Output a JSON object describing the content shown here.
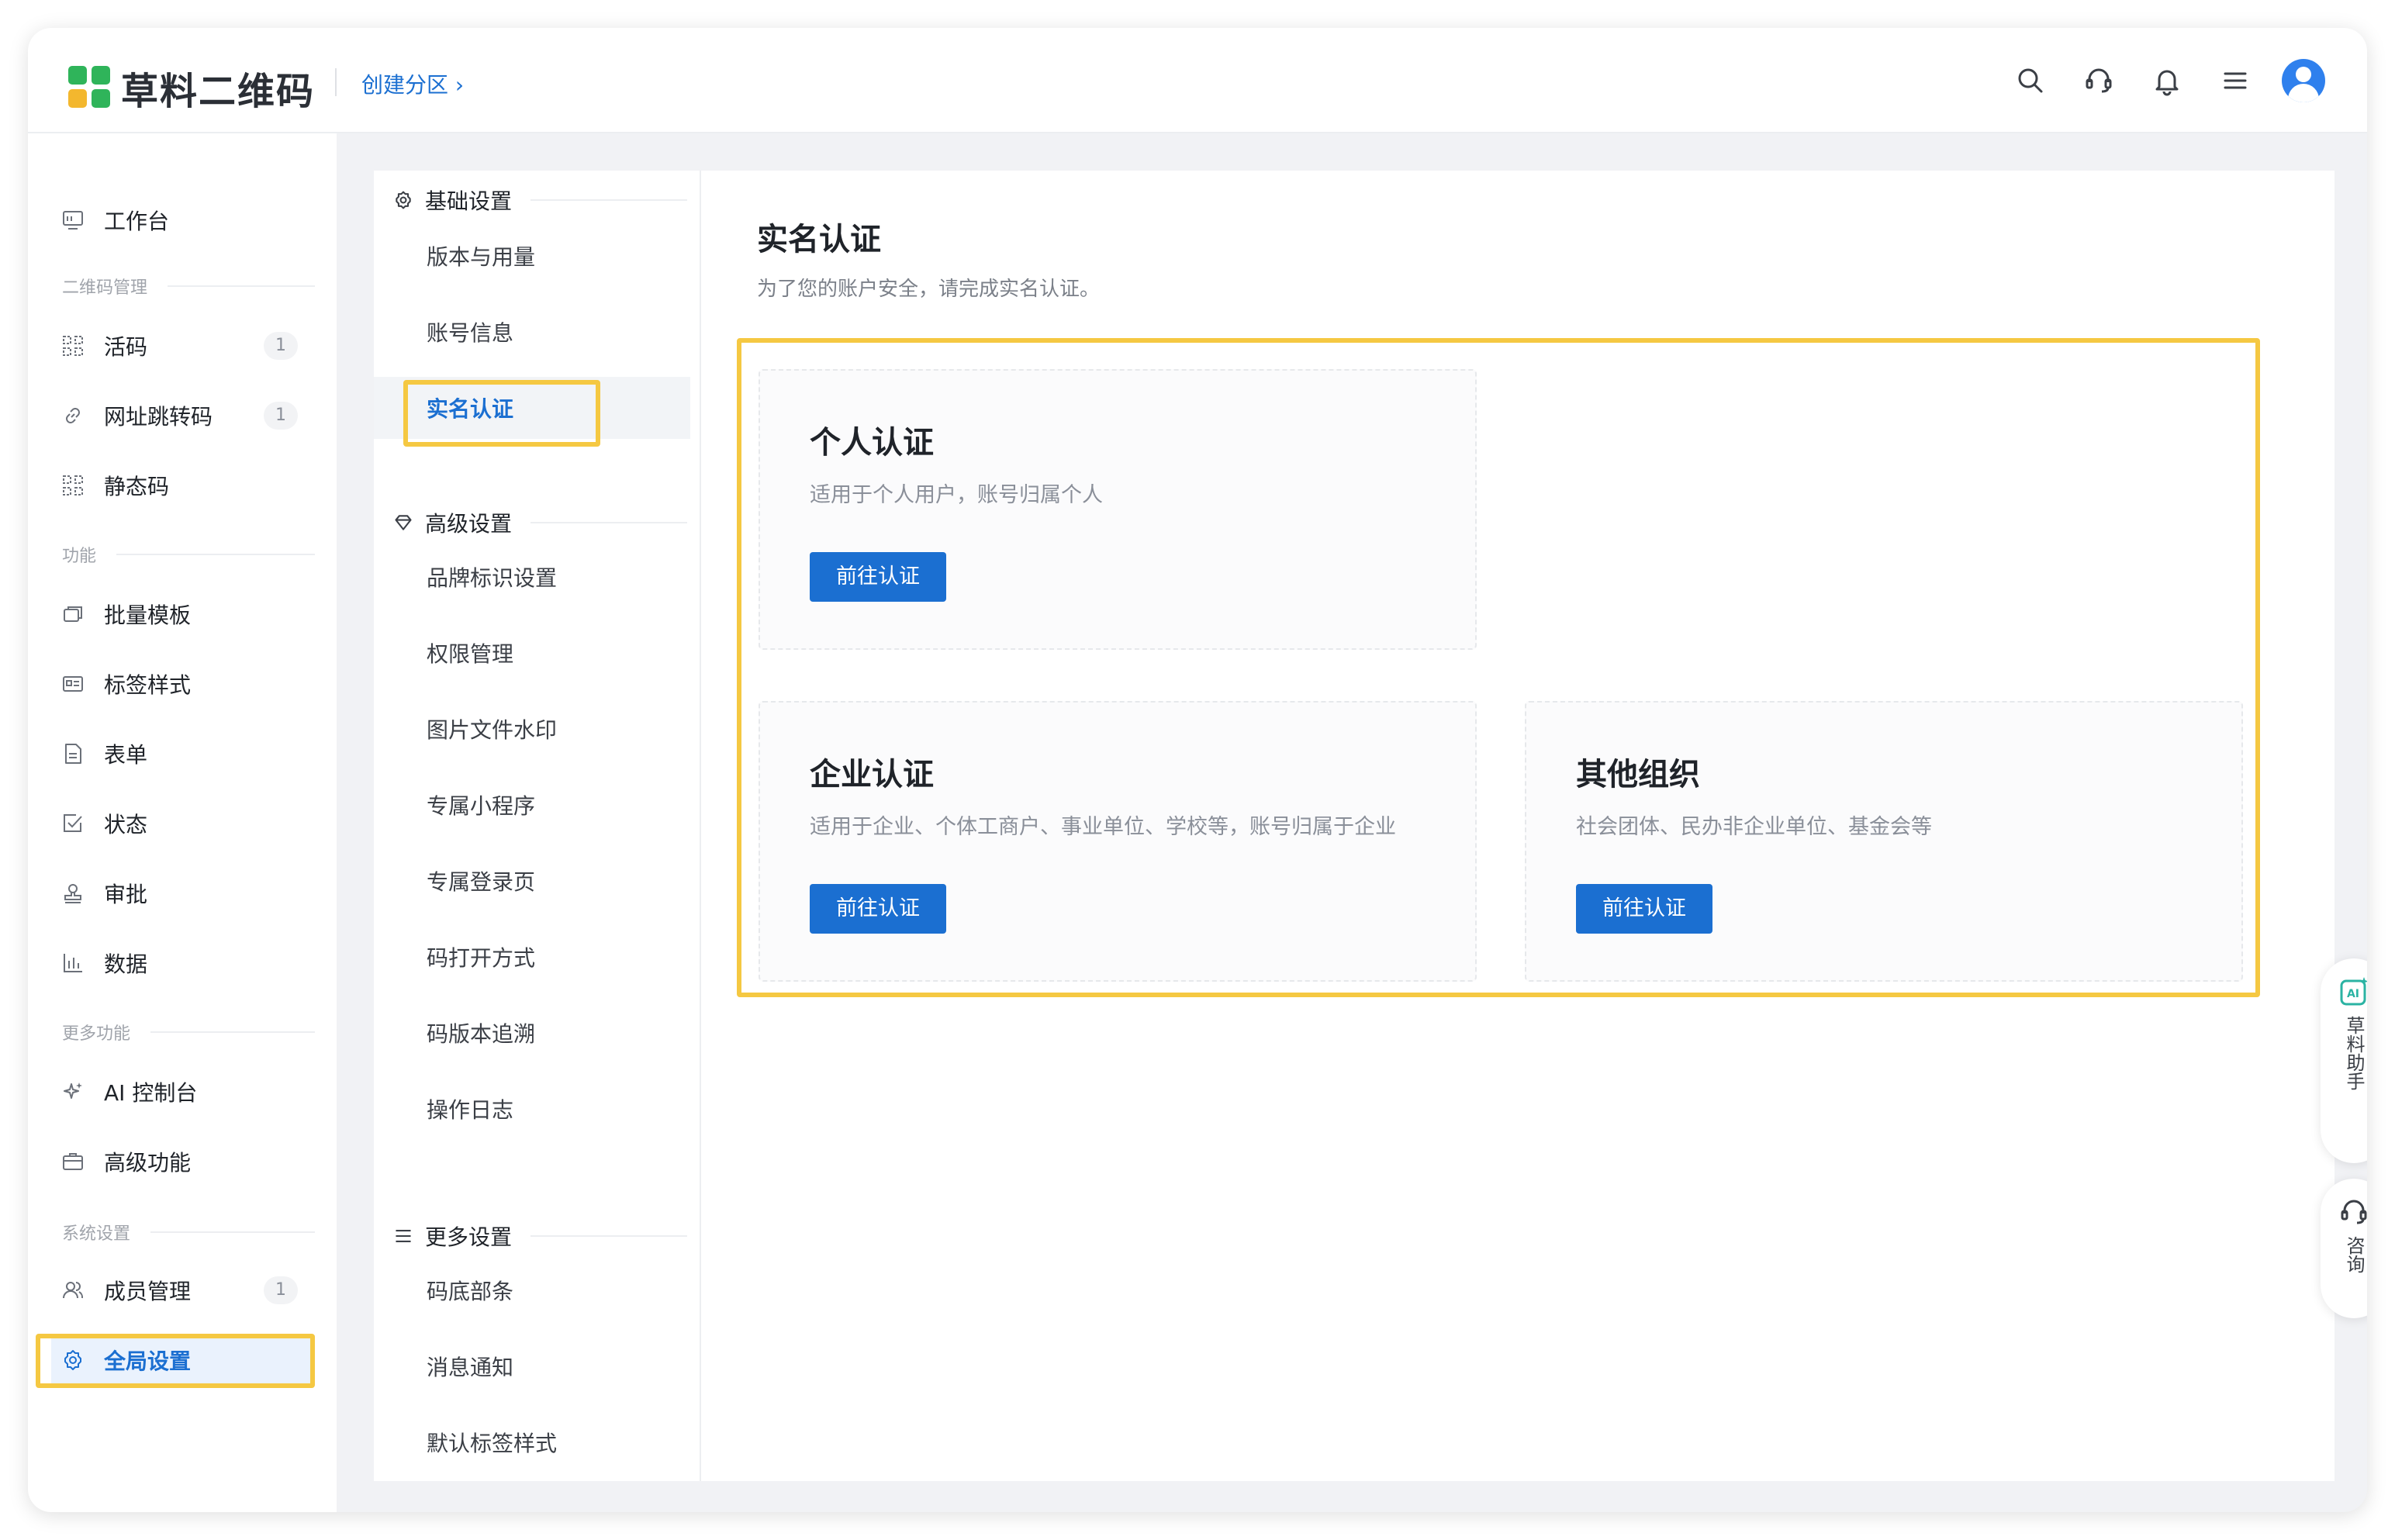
{
  "app": {
    "name": "草料二维码",
    "breadcrumb": "创建分区 ›",
    "brand_color": "#1b6fd1",
    "highlight_color": "#f5c842"
  },
  "header": {
    "icons": [
      "search-icon",
      "support-headset-icon",
      "bell-icon",
      "menu-icon",
      "user-avatar"
    ]
  },
  "sidebar": {
    "workbench": "工作台",
    "groups": {
      "qr": "二维码管理",
      "func": "功能",
      "more": "更多功能",
      "system": "系统设置"
    },
    "items": {
      "live": {
        "label": "活码",
        "count": "1"
      },
      "url": {
        "label": "网址跳转码",
        "count": "1"
      },
      "static": {
        "label": "静态码"
      },
      "batch": {
        "label": "批量模板"
      },
      "label_style": {
        "label": "标签样式"
      },
      "form": {
        "label": "表单"
      },
      "status": {
        "label": "状态"
      },
      "approval": {
        "label": "审批"
      },
      "data": {
        "label": "数据"
      },
      "ai": {
        "label": "AI 控制台"
      },
      "advanced": {
        "label": "高级功能"
      },
      "members": {
        "label": "成员管理",
        "count": "1"
      },
      "global": {
        "label": "全局设置"
      }
    }
  },
  "settings": {
    "basic": {
      "title": "基础设置",
      "items": [
        "版本与用量",
        "账号信息",
        "实名认证"
      ]
    },
    "advanced": {
      "title": "高级设置",
      "items": [
        "品牌标识设置",
        "权限管理",
        "图片文件水印",
        "专属小程序",
        "专属登录页",
        "码打开方式",
        "码版本追溯",
        "操作日志"
      ]
    },
    "more": {
      "title": "更多设置",
      "items": [
        "码底部条",
        "消息通知",
        "默认标签样式"
      ]
    },
    "active": "实名认证"
  },
  "main": {
    "title": "实名认证",
    "desc": "为了您的账户安全，请完成实名认证。",
    "cards": {
      "personal": {
        "title": "个人认证",
        "desc": "适用于个人用户，账号归属个人",
        "button": "前往认证"
      },
      "enterprise": {
        "title": "企业认证",
        "desc": "适用于企业、个体工商户、事业单位、学校等，账号归属于企业",
        "button": "前往认证"
      },
      "other": {
        "title": "其他组织",
        "desc": "社会团体、民办非企业单位、基金会等",
        "button": "前往认证"
      }
    }
  },
  "floating": {
    "assistant": "草料助手",
    "consult": "咨询"
  }
}
